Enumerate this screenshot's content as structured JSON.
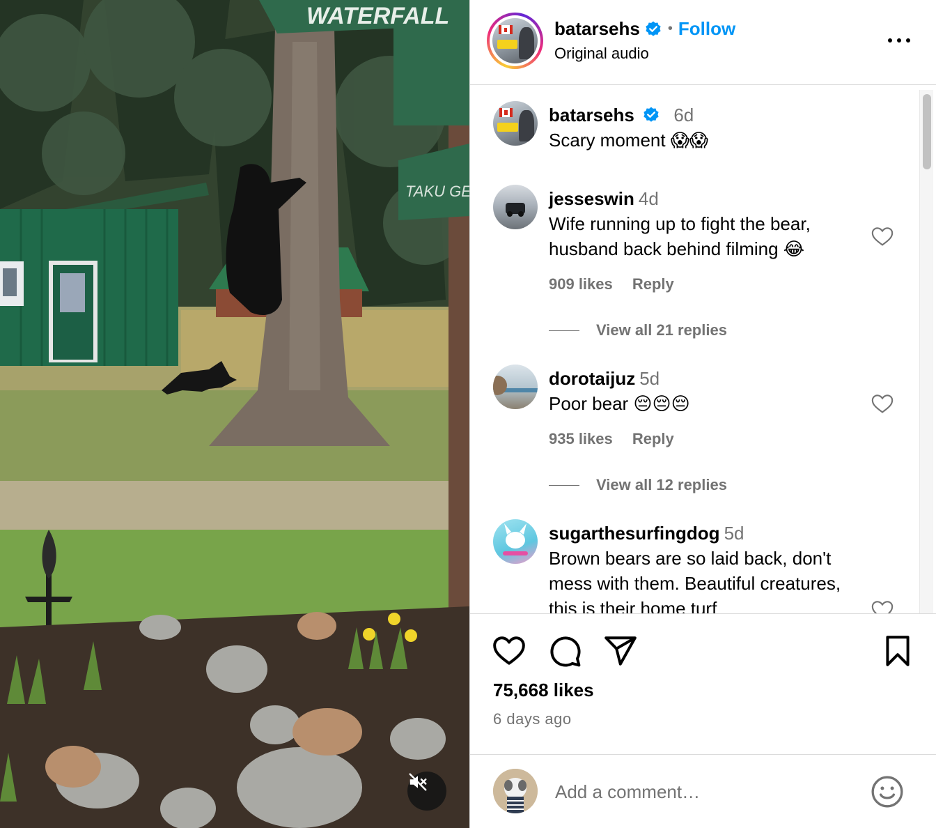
{
  "post": {
    "owner": "batarsehs",
    "follow_label": "Follow",
    "dot": "•",
    "audio": "Original audio",
    "likes": "75,668 likes",
    "date": "6 days ago"
  },
  "sign_text": {
    "top_sign": "WATERFALL",
    "lower_sign": "TAKU GENERAL"
  },
  "caption": {
    "user": "batarsehs",
    "time": "6d",
    "text": "Scary moment 😱😱"
  },
  "comments": [
    {
      "user": "jesseswin",
      "time": "4d",
      "text": "Wife running up to fight the bear, husband back behind filming 😂",
      "likes": "909 likes",
      "reply": "Reply",
      "view_replies": "View all 21 replies"
    },
    {
      "user": "dorotaijuz",
      "time": "5d",
      "text": "Poor bear 😔😔😔",
      "likes": "935 likes",
      "reply": "Reply",
      "view_replies": "View all 12 replies"
    },
    {
      "user": "sugarthesurfingdog",
      "time": "5d",
      "text": "Brown bears are so laid back, don't mess with them. Beautiful creatures, this is their home turf"
    }
  ],
  "add_comment": {
    "placeholder": "Add a comment…"
  },
  "colors": {
    "accent": "#0095f6",
    "secondary_text": "#737373",
    "divider": "#dbdbdb"
  },
  "icons": {
    "verified": "verified-badge-icon",
    "more": "more-options-icon",
    "like": "heart-icon",
    "comment": "comment-bubble-icon",
    "share": "paper-plane-icon",
    "save": "bookmark-icon",
    "emoji": "smiley-icon",
    "mute": "speaker-muted-icon"
  }
}
